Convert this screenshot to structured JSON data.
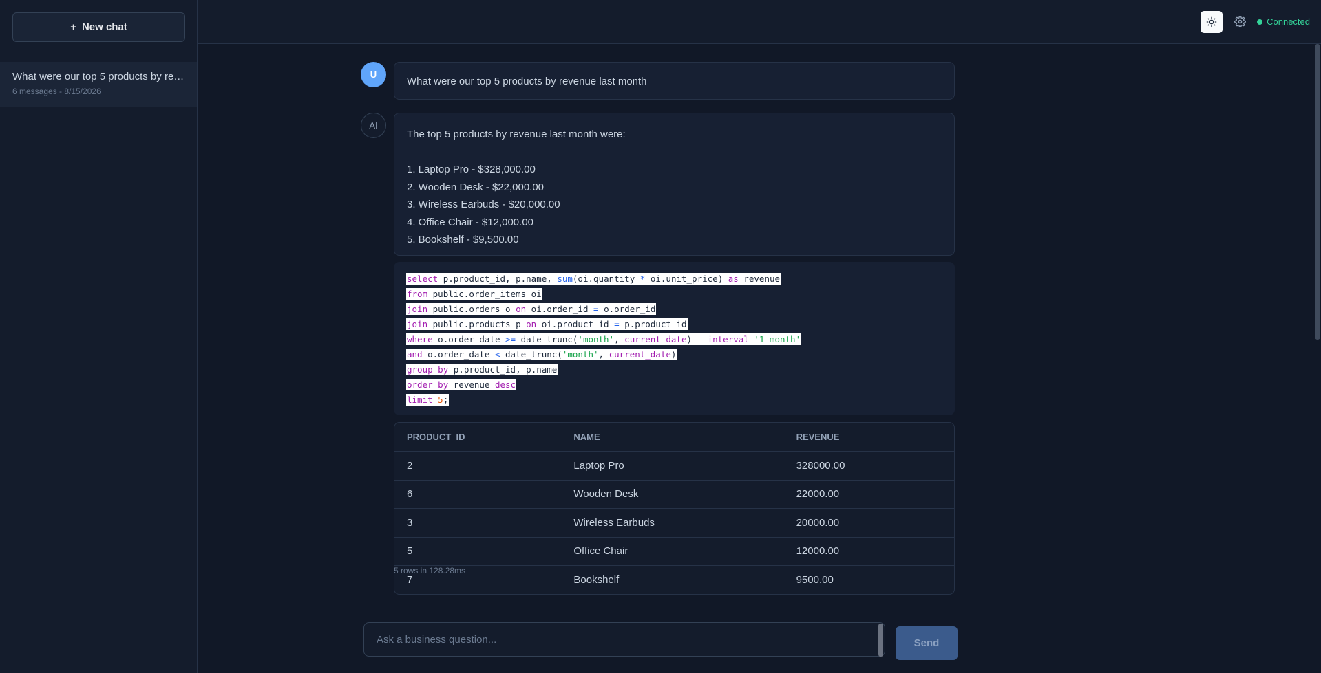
{
  "sidebar": {
    "new_chat_plus": "+",
    "new_chat_label": "New chat",
    "chats": [
      {
        "title": "What were our top 5 products by revenue last month",
        "meta": "6 messages - 8/15/2026"
      }
    ]
  },
  "topbar": {
    "status_label": "Connected",
    "theme_icon": "sun-icon",
    "settings_icon": "gear-icon",
    "status_color": "#34d399"
  },
  "messages": {
    "user": {
      "avatar": "U",
      "text": "What were our top 5 products by revenue last month"
    },
    "ai": {
      "avatar": "AI",
      "lead": "The top 5 products by revenue last month were:",
      "items": [
        "1. Laptop Pro - $328,000.00",
        "2. Wooden Desk - $22,000.00",
        "3. Wireless Earbuds - $20,000.00",
        "4. Office Chair - $12,000.00",
        "5. Bookshelf - $9,500.00"
      ]
    }
  },
  "sql": [
    "select p.product_id, p.name, sum(oi.quantity * oi.unit_price) as revenue",
    "from public.order_items oi",
    "join public.orders o on oi.order_id = o.order_id",
    "join public.products p on oi.product_id = p.product_id",
    "where o.order_date >= date_trunc('month', current_date) - interval '1 month'",
    "and o.order_date < date_trunc('month', current_date)",
    "group by p.product_id, p.name",
    "order by revenue desc",
    "limit 5;"
  ],
  "table": {
    "headers": [
      "PRODUCT_ID",
      "NAME",
      "REVENUE"
    ],
    "rows": [
      [
        "2",
        "Laptop Pro",
        "328000.00"
      ],
      [
        "6",
        "Wooden Desk",
        "22000.00"
      ],
      [
        "3",
        "Wireless Earbuds",
        "20000.00"
      ],
      [
        "5",
        "Office Chair",
        "12000.00"
      ],
      [
        "7",
        "Bookshelf",
        "9500.00"
      ]
    ],
    "footer": "5 rows in 128.28ms"
  },
  "composer": {
    "placeholder": "Ask a business question...",
    "value": "",
    "send_label": "Send"
  }
}
